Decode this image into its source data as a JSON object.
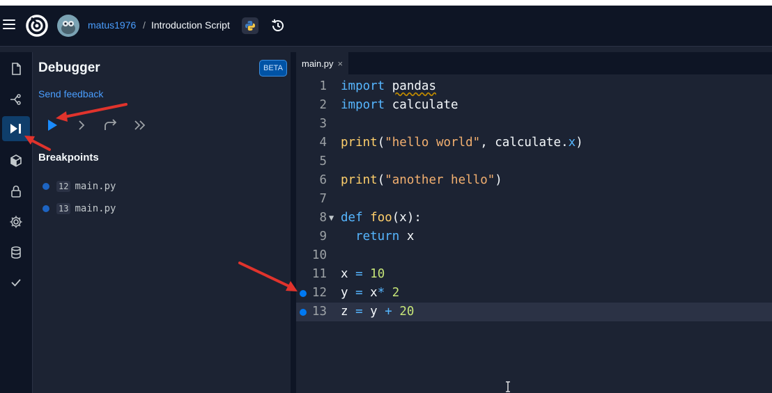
{
  "header": {
    "username": "matus1976",
    "separator": "/",
    "repl_title": "Introduction Script"
  },
  "iconbar": {
    "items": [
      {
        "name": "files-icon"
      },
      {
        "name": "git-icon"
      },
      {
        "name": "debugger-icon",
        "active": true
      },
      {
        "name": "packages-icon"
      },
      {
        "name": "secrets-icon"
      },
      {
        "name": "settings-icon"
      },
      {
        "name": "database-icon"
      },
      {
        "name": "checkmark-icon"
      }
    ]
  },
  "debugger": {
    "title": "Debugger",
    "badge": "BETA",
    "feedback_link": "Send feedback",
    "breakpoints_title": "Breakpoints",
    "breakpoints": [
      {
        "line": "12",
        "file": "main.py"
      },
      {
        "line": "13",
        "file": "main.py"
      }
    ]
  },
  "editor": {
    "tab_label": "main.py",
    "tab_close": "×",
    "current_line": 13,
    "lines": [
      {
        "n": "1",
        "text": "import pandas"
      },
      {
        "n": "2",
        "text": "import calculate"
      },
      {
        "n": "3",
        "text": ""
      },
      {
        "n": "4",
        "text": "print(\"hello world\", calculate.x)"
      },
      {
        "n": "5",
        "text": ""
      },
      {
        "n": "6",
        "text": "print(\"another hello\")"
      },
      {
        "n": "7",
        "text": ""
      },
      {
        "n": "8",
        "text": "def foo(x):"
      },
      {
        "n": "9",
        "text": "  return x"
      },
      {
        "n": "10",
        "text": ""
      },
      {
        "n": "11",
        "text": "x = 10"
      },
      {
        "n": "12",
        "text": "y = x* 2"
      },
      {
        "n": "13",
        "text": "z = y + 20"
      }
    ],
    "breakpoint_lines": [
      12,
      13
    ]
  },
  "colors": {
    "accent": "#0079f2",
    "link": "#4a9eff",
    "annotation_arrow": "#e0332c",
    "background": "#1c2333"
  }
}
